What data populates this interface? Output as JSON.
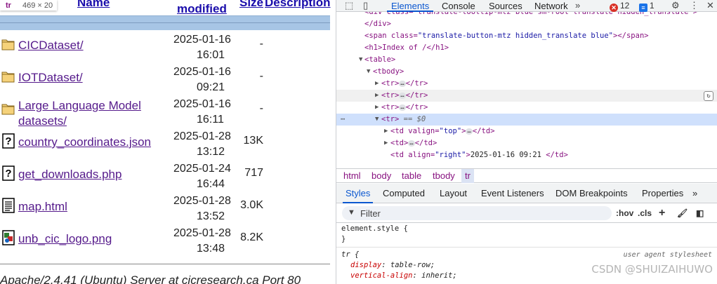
{
  "listing": {
    "header": {
      "name": "Name",
      "modified": "modified",
      "size": "Size",
      "description": "Description"
    },
    "tooltip": {
      "tag": "tr",
      "dims": "469 × 20"
    },
    "rows": [
      {
        "icon": "folder-icon",
        "name": "CICDataset/",
        "date": "2025-01-16",
        "time": "16:01",
        "size": "-"
      },
      {
        "icon": "folder-icon",
        "name": "IOTDataset/",
        "date": "2025-01-16",
        "time": "09:21",
        "size": "-"
      },
      {
        "icon": "folder-icon",
        "name": "Large Language Model",
        "name2": "datasets/",
        "date": "2025-01-16",
        "time": "16:11",
        "size": "-"
      },
      {
        "icon": "unknown-file-icon",
        "name": "country_coordinates.json",
        "date": "2025-01-28",
        "time": "13:12",
        "size": "13K"
      },
      {
        "icon": "unknown-file-icon",
        "name": "get_downloads.php",
        "date": "2025-01-24",
        "time": "16:44",
        "size": "717"
      },
      {
        "icon": "text-file-icon",
        "name": "map.html",
        "date": "2025-01-28",
        "time": "13:52",
        "size": "3.0K"
      },
      {
        "icon": "image-file-icon",
        "name": "unb_cic_logo.png",
        "date": "2025-01-28",
        "time": "13:48",
        "size": "8.2K"
      }
    ],
    "address": "Apache/2.4.41 (Ubuntu) Server at cicresearch.ca Port 80"
  },
  "devtools": {
    "tabs": {
      "elements": "Elements",
      "console": "Console",
      "sources": "Sources",
      "network": "Network"
    },
    "errors": "12",
    "messages": "1",
    "colors": {
      "accent": "#0b57d0",
      "error": "#d93025",
      "info": "#1a73e8",
      "selected": "#cfe0fc"
    },
    "dom": {
      "l0": "<div class=\"translate-tooltip-mtz blue sm-root translate hidden_translate\">",
      "l1": "</div>",
      "l2": {
        "pre": "<span class=",
        "val": "\"translate-button-mtz hidden_translate blue\"",
        "post": "></span>"
      },
      "l3": "<h1>Index of /</h1>",
      "l4": "<table>",
      "l5": "<tbody>",
      "tr_open": "<tr>",
      "tr_close": "</tr>",
      "ellipsis": "…",
      "sel_marker": "== $0",
      "td_valign": {
        "pre": "<td valign=",
        "val": "\"top\"",
        "post": ">"
      },
      "td_close": "</td>",
      "td_plain": "<td>",
      "td_align": {
        "pre": "<td align=",
        "val": "\"right\"",
        "post": ">",
        "text": "2025-01-16 09:21 ",
        "close": "</td>"
      }
    },
    "breadcrumbs": [
      "html",
      "body",
      "table",
      "tbody",
      "tr"
    ],
    "subtabs": [
      "Styles",
      "Computed",
      "Layout",
      "Event Listeners",
      "DOM Breakpoints",
      "Properties"
    ],
    "filter_placeholder": "Filter",
    "hov": ":hov",
    "cls": ".cls",
    "styles": {
      "element_style": "element.style {",
      "close": "}",
      "tr_selector": "tr {",
      "ua_label": "user agent stylesheet",
      "prop1": "display",
      "val1": "table-row;",
      "prop2": "vertical-align",
      "val2": "inherit;"
    },
    "watermark": "CSDN @SHUIZAIHUWO"
  }
}
